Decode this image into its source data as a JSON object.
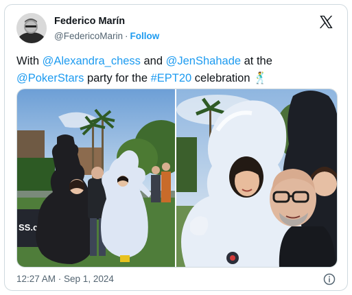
{
  "author": {
    "name": "Federico Marín",
    "handle": "@FedericoMarin",
    "separator": "·",
    "follow_label": "Follow"
  },
  "tweet": {
    "seg1": "With ",
    "mention1": "@Alexandra_chess",
    "seg2": " and ",
    "mention2": "@JenShahade",
    "seg3": " at the ",
    "mention3": "@PokerStars",
    "seg4": " party for the ",
    "hashtag": "#EPT20",
    "seg5": " celebration ",
    "emoji": "🕺"
  },
  "media": {
    "left_sign_text": "SS.co"
  },
  "footer": {
    "timestamp": "12:27 AM · Sep 1, 2024"
  },
  "colors": {
    "accent": "#1d9bf0",
    "text": "#0f1419",
    "muted": "#536471",
    "border": "#cfd9de"
  },
  "icons": {
    "brand": "x-logo-icon",
    "info": "info-icon"
  }
}
